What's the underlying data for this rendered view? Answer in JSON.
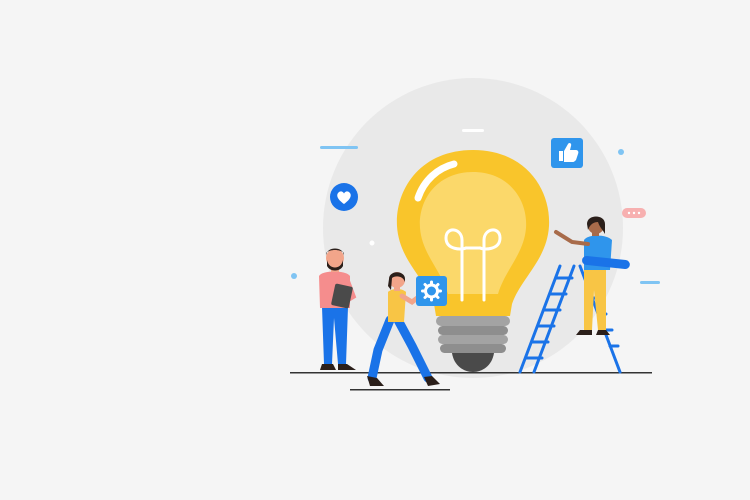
{
  "colors": {
    "background": "#f5f5f5",
    "halo": "#e8e8e8",
    "bulb_yellow": "#f9c52b",
    "bulb_light": "#fbd86a",
    "bulb_inner": "#f8df94",
    "filament": "#ffffff",
    "socket_gray": "#a3a3a3",
    "socket_dark": "#4a4a4a",
    "blue_primary": "#1a73e8",
    "blue_light": "#2f95ec",
    "navy": "#10306c",
    "skin": "#f2a58a",
    "skin_dark": "#a86b4a",
    "hair_dark": "#2b1f1a",
    "shirt_pink": "#f58d8d",
    "shirt_yellow": "#f8c545",
    "accent_sky": "#7fc4f3",
    "accent_pink": "#f7b0b0",
    "ground": "#333333"
  },
  "icons": {
    "heart": "heart-icon",
    "thumbs_up": "thumbs-up-icon",
    "gear": "gear-icon",
    "tablet": "tablet-icon",
    "chat": "chat-bubble-icon"
  }
}
